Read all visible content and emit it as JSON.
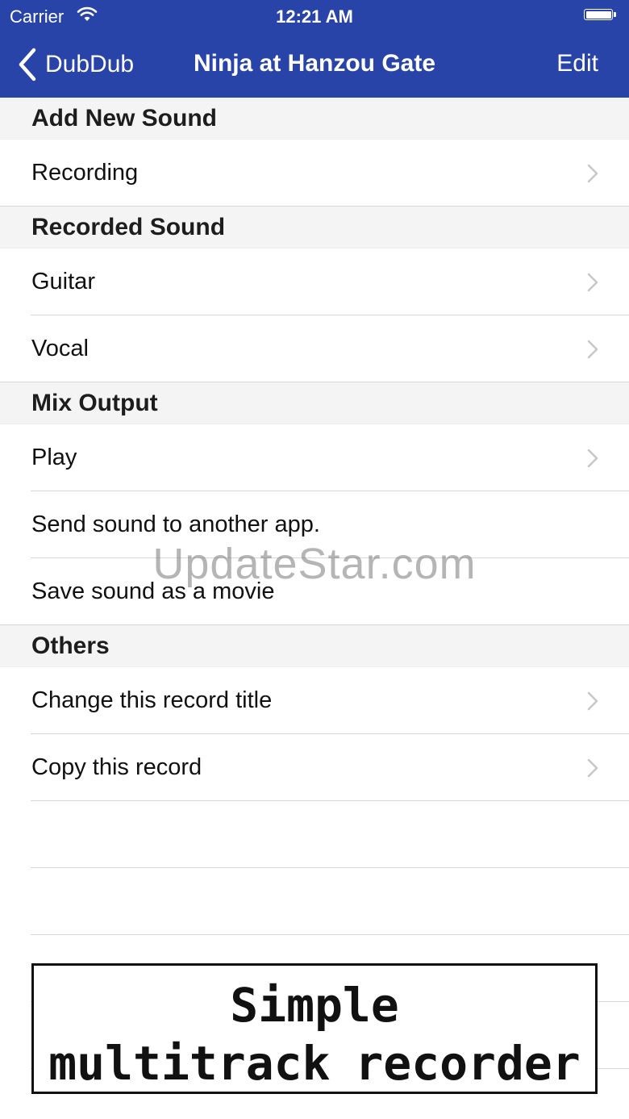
{
  "status_bar": {
    "carrier": "Carrier",
    "time": "12:21 AM",
    "wifi_icon": "wifi-icon",
    "battery_icon": "battery-icon"
  },
  "nav": {
    "back_label": "DubDub",
    "title": "Ninja at Hanzou Gate",
    "edit_label": "Edit",
    "bar_color": "#2844a8"
  },
  "sections": [
    {
      "header": "Add New Sound",
      "rows": [
        {
          "label": "Recording",
          "chevron": true
        }
      ]
    },
    {
      "header": "Recorded Sound",
      "rows": [
        {
          "label": "Guitar",
          "chevron": true
        },
        {
          "label": "Vocal",
          "chevron": true
        }
      ]
    },
    {
      "header": "Mix Output",
      "rows": [
        {
          "label": "Play",
          "chevron": true
        },
        {
          "label": "Send sound to another app.",
          "chevron": false
        },
        {
          "label": "Save sound as a movie",
          "chevron": false
        }
      ]
    },
    {
      "header": "Others",
      "rows": [
        {
          "label": "Change this record title",
          "chevron": true
        },
        {
          "label": "Copy this record",
          "chevron": true
        }
      ]
    }
  ],
  "banner": {
    "line1": "Simple",
    "line2": "multitrack recorder"
  },
  "watermark": "UpdateStar.com"
}
